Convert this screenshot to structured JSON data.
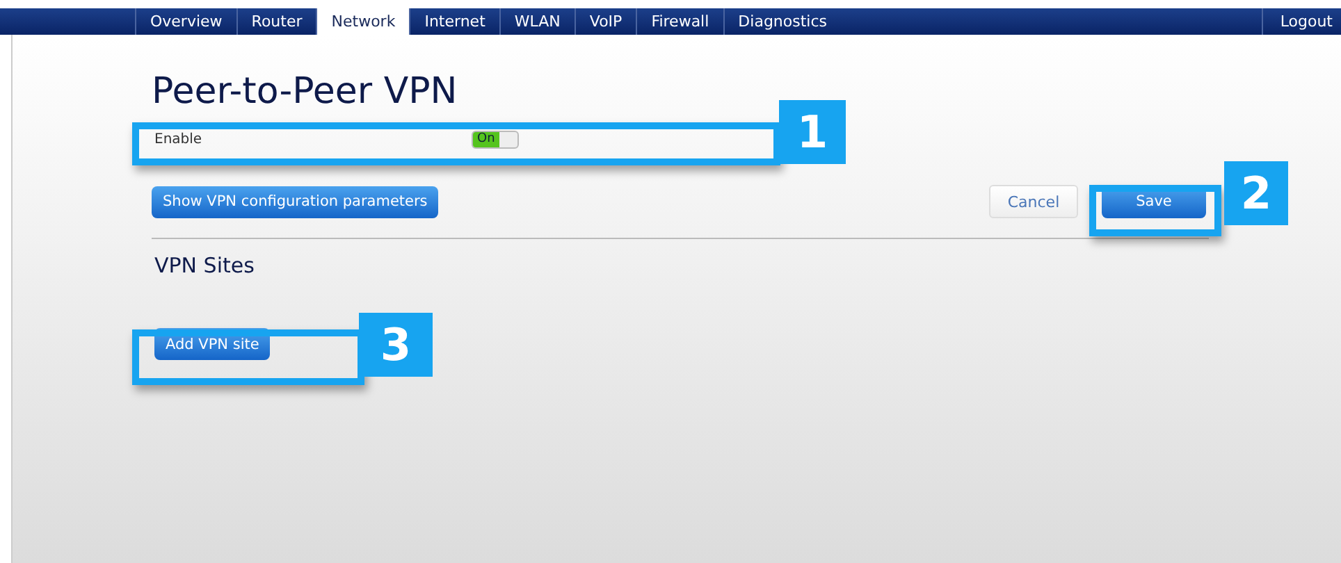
{
  "nav": {
    "tabs": [
      {
        "label": "Overview",
        "selected": false
      },
      {
        "label": "Router",
        "selected": false
      },
      {
        "label": "Network",
        "selected": true
      },
      {
        "label": "Internet",
        "selected": false
      },
      {
        "label": "WLAN",
        "selected": false
      },
      {
        "label": "VoIP",
        "selected": false
      },
      {
        "label": "Firewall",
        "selected": false
      },
      {
        "label": "Diagnostics",
        "selected": false
      }
    ],
    "logout": "Logout"
  },
  "title": "Peer-to-Peer VPN",
  "enable": {
    "label": "Enable",
    "toggle_text": "On",
    "on": true
  },
  "show_config_button": "Show VPN configuration parameters",
  "cancel_button": "Cancel",
  "save_button": "Save",
  "section_title": "VPN Sites",
  "add_site_button": "Add VPN site",
  "callouts": [
    "1",
    "2",
    "3"
  ]
}
